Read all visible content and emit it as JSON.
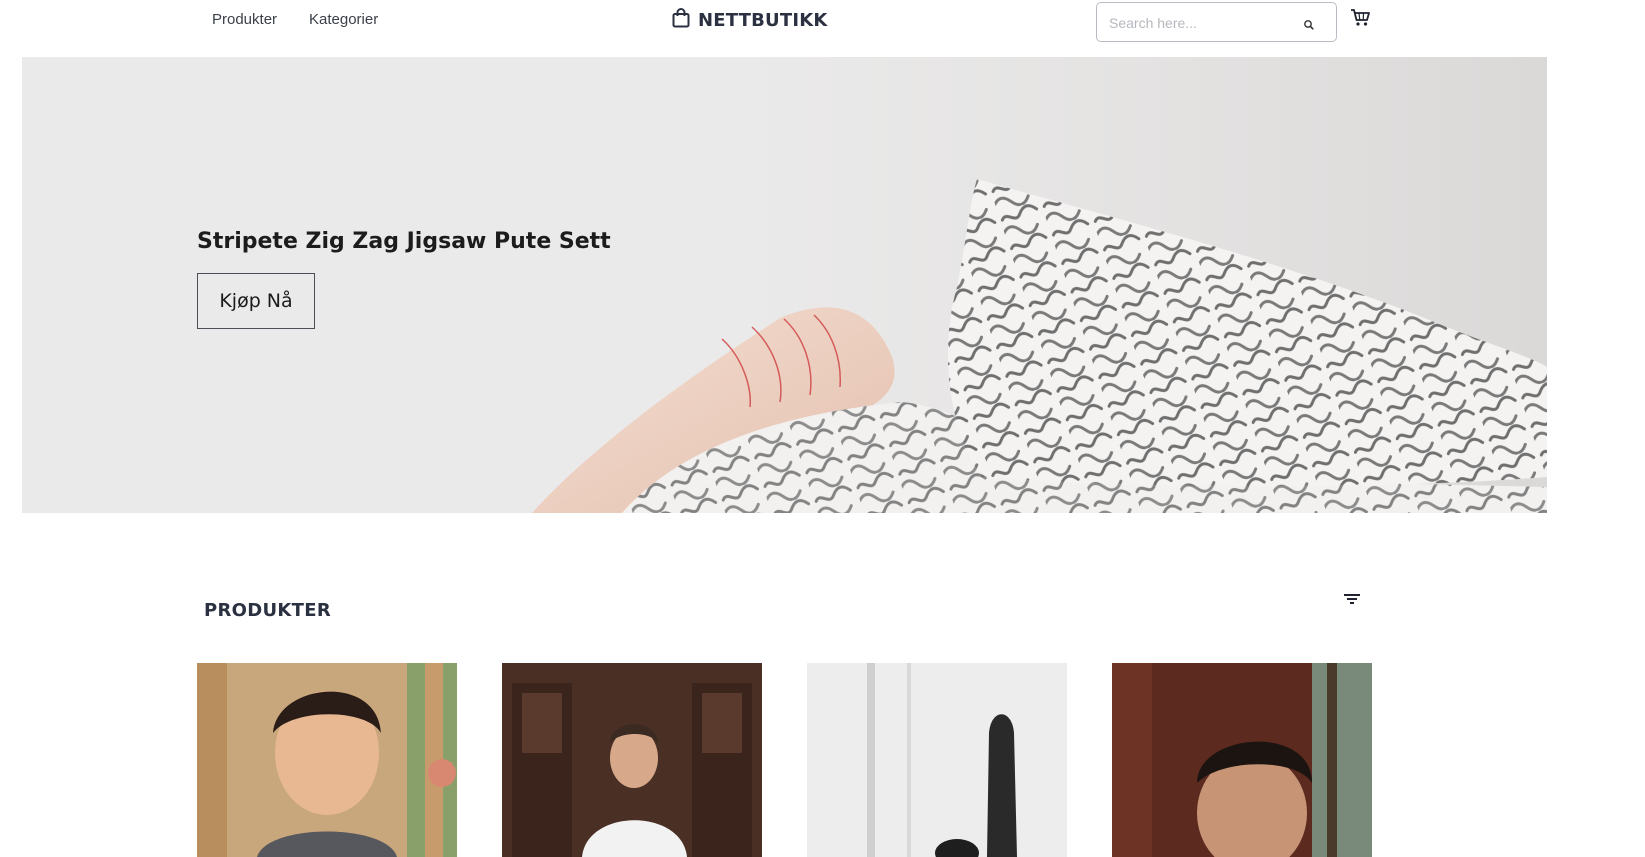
{
  "nav": {
    "produkter": "Produkter",
    "kategorier": "Kategorier"
  },
  "logo": {
    "text": "NETTBUTIKK",
    "icon": "shopping-bag-icon"
  },
  "search": {
    "placeholder": "Search here...",
    "value": "",
    "icon": "search-icon"
  },
  "cart": {
    "icon": "cart-icon"
  },
  "hero": {
    "title": "Stripete Zig Zag Jigsaw Pute Sett",
    "button_label": "Kjøp Nå"
  },
  "products": {
    "title": "PRODUKTER",
    "filter_icon": "filter-icon",
    "items": [
      {
        "image": "portrait of young man in grey shirt"
      },
      {
        "image": "man in white t-shirt in front of carved wooden door"
      },
      {
        "image": "black and white photo of surfboard against wall"
      },
      {
        "image": "portrait of man with dark hair in warm interior"
      }
    ]
  },
  "colors": {
    "text_dark": "#2b3141",
    "hero_bg": "#ebeaea",
    "border": "#b9bcc2"
  }
}
